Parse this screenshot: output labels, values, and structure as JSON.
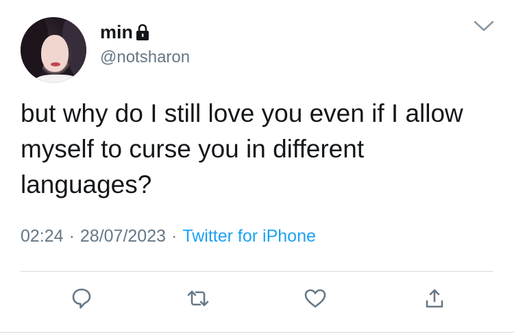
{
  "author": {
    "name": "min",
    "handle": "@notsharon",
    "locked": true,
    "avatar_icon": "avatar-photo"
  },
  "tweet": {
    "text": "but why do I still love you even if I allow myself to curse you in different languages?",
    "time": "02:24",
    "date": "28/07/2023",
    "separator": "·",
    "source": "Twitter for iPhone"
  },
  "actions": [
    {
      "name": "reply",
      "icon": "reply-icon"
    },
    {
      "name": "retweet",
      "icon": "retweet-icon"
    },
    {
      "name": "like",
      "icon": "heart-icon"
    },
    {
      "name": "share",
      "icon": "share-icon"
    }
  ],
  "colors": {
    "text": "#14171a",
    "secondary": "#657786",
    "link": "#1da1f2",
    "divider": "#d5dade"
  }
}
